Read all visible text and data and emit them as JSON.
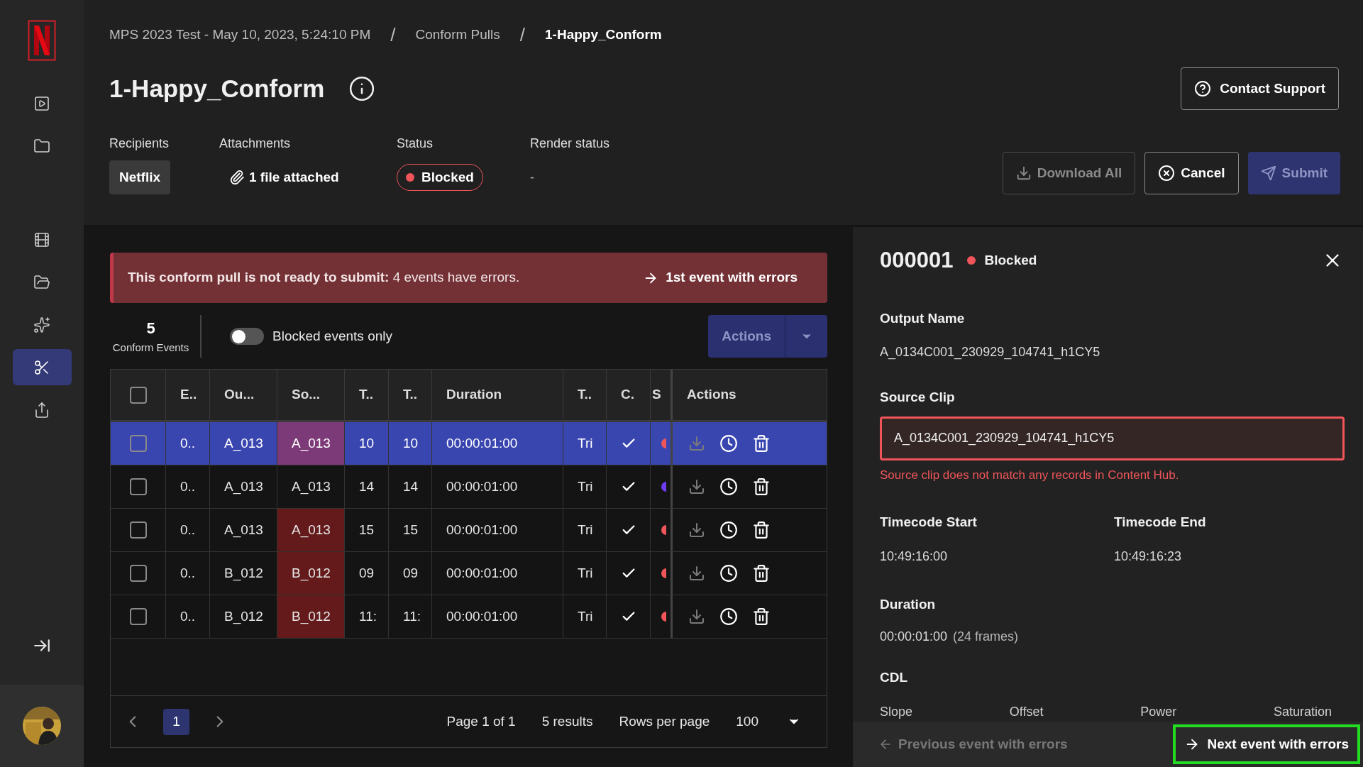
{
  "sidebar": {
    "items": [
      {
        "kind": "play",
        "selected": false
      },
      {
        "kind": "folder",
        "selected": false
      },
      {
        "kind": "film",
        "selected": false
      },
      {
        "kind": "folder-open",
        "selected": false
      },
      {
        "kind": "sparkle",
        "selected": false
      },
      {
        "kind": "scissors",
        "selected": true
      },
      {
        "kind": "share",
        "selected": false
      }
    ]
  },
  "breadcrumb": {
    "items": [
      {
        "label": "MPS 2023 Test - May 10, 2023, 5:24:10 PM",
        "current": false
      },
      {
        "label": "Conform Pulls",
        "current": false
      },
      {
        "label": "1-Happy_Conform",
        "current": true
      }
    ],
    "separators": [
      "/",
      "/"
    ]
  },
  "title": "1-Happy_Conform",
  "contact_button": "Contact Support",
  "meta": {
    "recipients": {
      "label": "Recipients",
      "value": "Netflix"
    },
    "attachments": {
      "label": "Attachments",
      "value": "1 file attached"
    },
    "status": {
      "label": "Status",
      "value": "Blocked",
      "color": "#f0555a"
    },
    "render_status": {
      "label": "Render status",
      "value": "-"
    }
  },
  "buttons": [
    {
      "label": "Download All",
      "kind": "download",
      "disabled": true
    },
    {
      "label": "Cancel",
      "kind": "cancel",
      "disabled": false
    },
    {
      "label": "Submit",
      "kind": "submit",
      "disabled": true
    }
  ],
  "banner": {
    "text": "**This conform pull is not ready to submit:** 4 events have errors.",
    "link": "1st event with errors"
  },
  "summary": {
    "count": "5",
    "label": "Conform Events"
  },
  "toggle": {
    "label": "Blocked events only",
    "on": false
  },
  "actions_button": {
    "label": "Actions",
    "disabled": true
  },
  "table": {
    "columns": [
      "E..",
      "Ou...",
      "So...",
      "T..",
      "T..",
      "Duration",
      "T..",
      "C.",
      "S",
      "Actions"
    ],
    "header_checked": false,
    "rows": [
      {
        "selected": true,
        "checked": false,
        "cells": [
          "0..",
          "A_013",
          "A_013",
          "10",
          "10",
          "00:00:01:00",
          "Tri"
        ],
        "source_error": true,
        "c_checked": true,
        "color": "#f0555a",
        "download_disabled": true
      },
      {
        "selected": false,
        "checked": false,
        "cells": [
          "0..",
          "A_013",
          "A_013",
          "14",
          "14",
          "00:00:01:00",
          "Tri"
        ],
        "source_error": false,
        "c_checked": true,
        "color": "#6e3bf0",
        "download_disabled": true
      },
      {
        "selected": false,
        "checked": false,
        "cells": [
          "0..",
          "A_013",
          "A_013",
          "15",
          "15",
          "00:00:01:00",
          "Tri"
        ],
        "source_error": true,
        "c_checked": true,
        "color": "#f0555a",
        "download_disabled": true
      },
      {
        "selected": false,
        "checked": false,
        "cells": [
          "0..",
          "B_012",
          "B_012",
          "09",
          "09",
          "00:00:01:00",
          "Tri"
        ],
        "source_error": true,
        "c_checked": true,
        "color": "#f0555a",
        "download_disabled": true
      },
      {
        "selected": false,
        "checked": false,
        "cells": [
          "0..",
          "B_012",
          "B_012",
          "11:",
          "11:",
          "00:00:01:00",
          "Tri"
        ],
        "source_error": true,
        "c_checked": true,
        "color": "#f0555a",
        "download_disabled": true
      }
    ]
  },
  "pagination": {
    "pages": [
      {
        "label": "1",
        "selected": true
      }
    ],
    "page_info": "Page 1 of 1",
    "results": "5 results",
    "rows_label": "Rows per page",
    "rows_value": "100"
  },
  "detail": {
    "id": "000001",
    "status": "Blocked",
    "color": "#f0555a",
    "output_name": {
      "label": "Output Name",
      "value": "A_0134C001_230929_104741_h1CY5"
    },
    "source_clip": {
      "label": "Source Clip",
      "value": "A_0134C001_230929_104741_h1CY5",
      "error": "Source clip does not match any records in Content Hub."
    },
    "timecode_start": {
      "label": "Timecode Start",
      "value": "10:49:16:00"
    },
    "timecode_end": {
      "label": "Timecode End",
      "value": "10:49:16:23"
    },
    "duration": {
      "label": "Duration",
      "value": "00:00:01:00",
      "note": "(24 frames)"
    },
    "cdl": {
      "label": "CDL",
      "columns": [
        "Slope",
        "Offset",
        "Power",
        "Saturation"
      ]
    },
    "prev": {
      "label": "Previous event with errors",
      "disabled": true
    },
    "next": {
      "label": "Next event with errors",
      "disabled": false,
      "highlighted": true
    }
  }
}
